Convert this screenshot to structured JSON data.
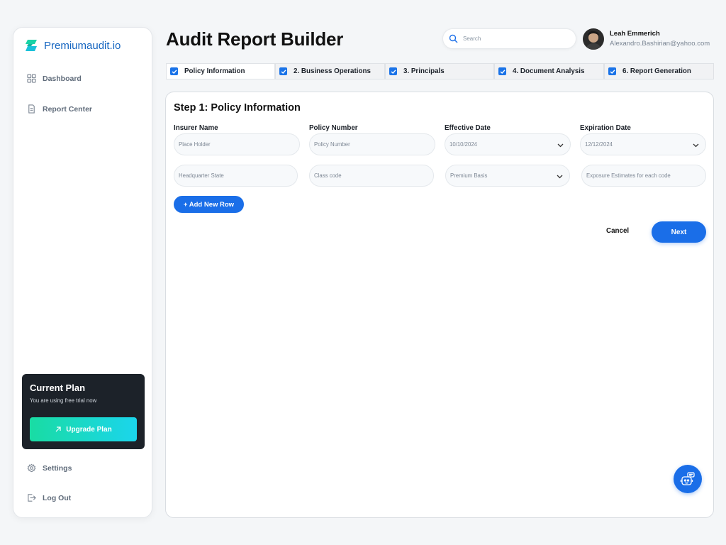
{
  "brand": {
    "name": "Premiumaudit.io"
  },
  "sidebar": {
    "items": [
      {
        "label": "Dashboard",
        "icon": "grid-icon"
      },
      {
        "label": "Report Center",
        "icon": "document-icon"
      }
    ],
    "plan": {
      "title": "Current Plan",
      "subtitle": "You are using free trial now",
      "upgrade_label": "Upgrade Plan"
    },
    "footer_items": [
      {
        "label": "Settings",
        "icon": "gear-icon"
      },
      {
        "label": "Log Out",
        "icon": "logout-icon"
      }
    ]
  },
  "header": {
    "title": "Audit Report Builder",
    "search_placeholder": "Search",
    "user": {
      "name": "Leah Emmerich",
      "email": "Alexandro.Bashirian@yahoo.com"
    }
  },
  "tabs": [
    {
      "label": "Policy Information",
      "checked": true,
      "active": true
    },
    {
      "label": "2. Business Operations",
      "checked": true,
      "active": false
    },
    {
      "label": "3. Principals",
      "checked": true,
      "active": false
    },
    {
      "label": "4. Document Analysis",
      "checked": true,
      "active": false
    },
    {
      "label": "6. Report Generation",
      "checked": true,
      "active": false
    }
  ],
  "form": {
    "step_title": "Step 1: Policy Information",
    "labels": {
      "insurer_name": "Insurer Name",
      "policy_number": "Policy Number",
      "effective_date": "Effective Date",
      "expiration_date": "Expiration Date"
    },
    "row1": {
      "insurer_name_placeholder": "Place Holder",
      "policy_number_placeholder": "Policy Number",
      "effective_date_value": "10/10/2024",
      "expiration_date_value": "12/12/2024"
    },
    "row2": {
      "headquarter_state_placeholder": "Headquarter State",
      "class_code_placeholder": "Class code",
      "premium_basis_value": "Premium Basis",
      "exposure_placeholder": "Exposure Estimates for each code"
    },
    "add_row_label": "+ Add New Row",
    "cancel_label": "Cancel",
    "next_label": "Next"
  },
  "colors": {
    "accent": "#1a6ee8",
    "brand": "#1565c0",
    "plan_bg": "#1c2229",
    "upgrade_gradient_start": "#19dca3",
    "upgrade_gradient_end": "#1bd5ec"
  }
}
